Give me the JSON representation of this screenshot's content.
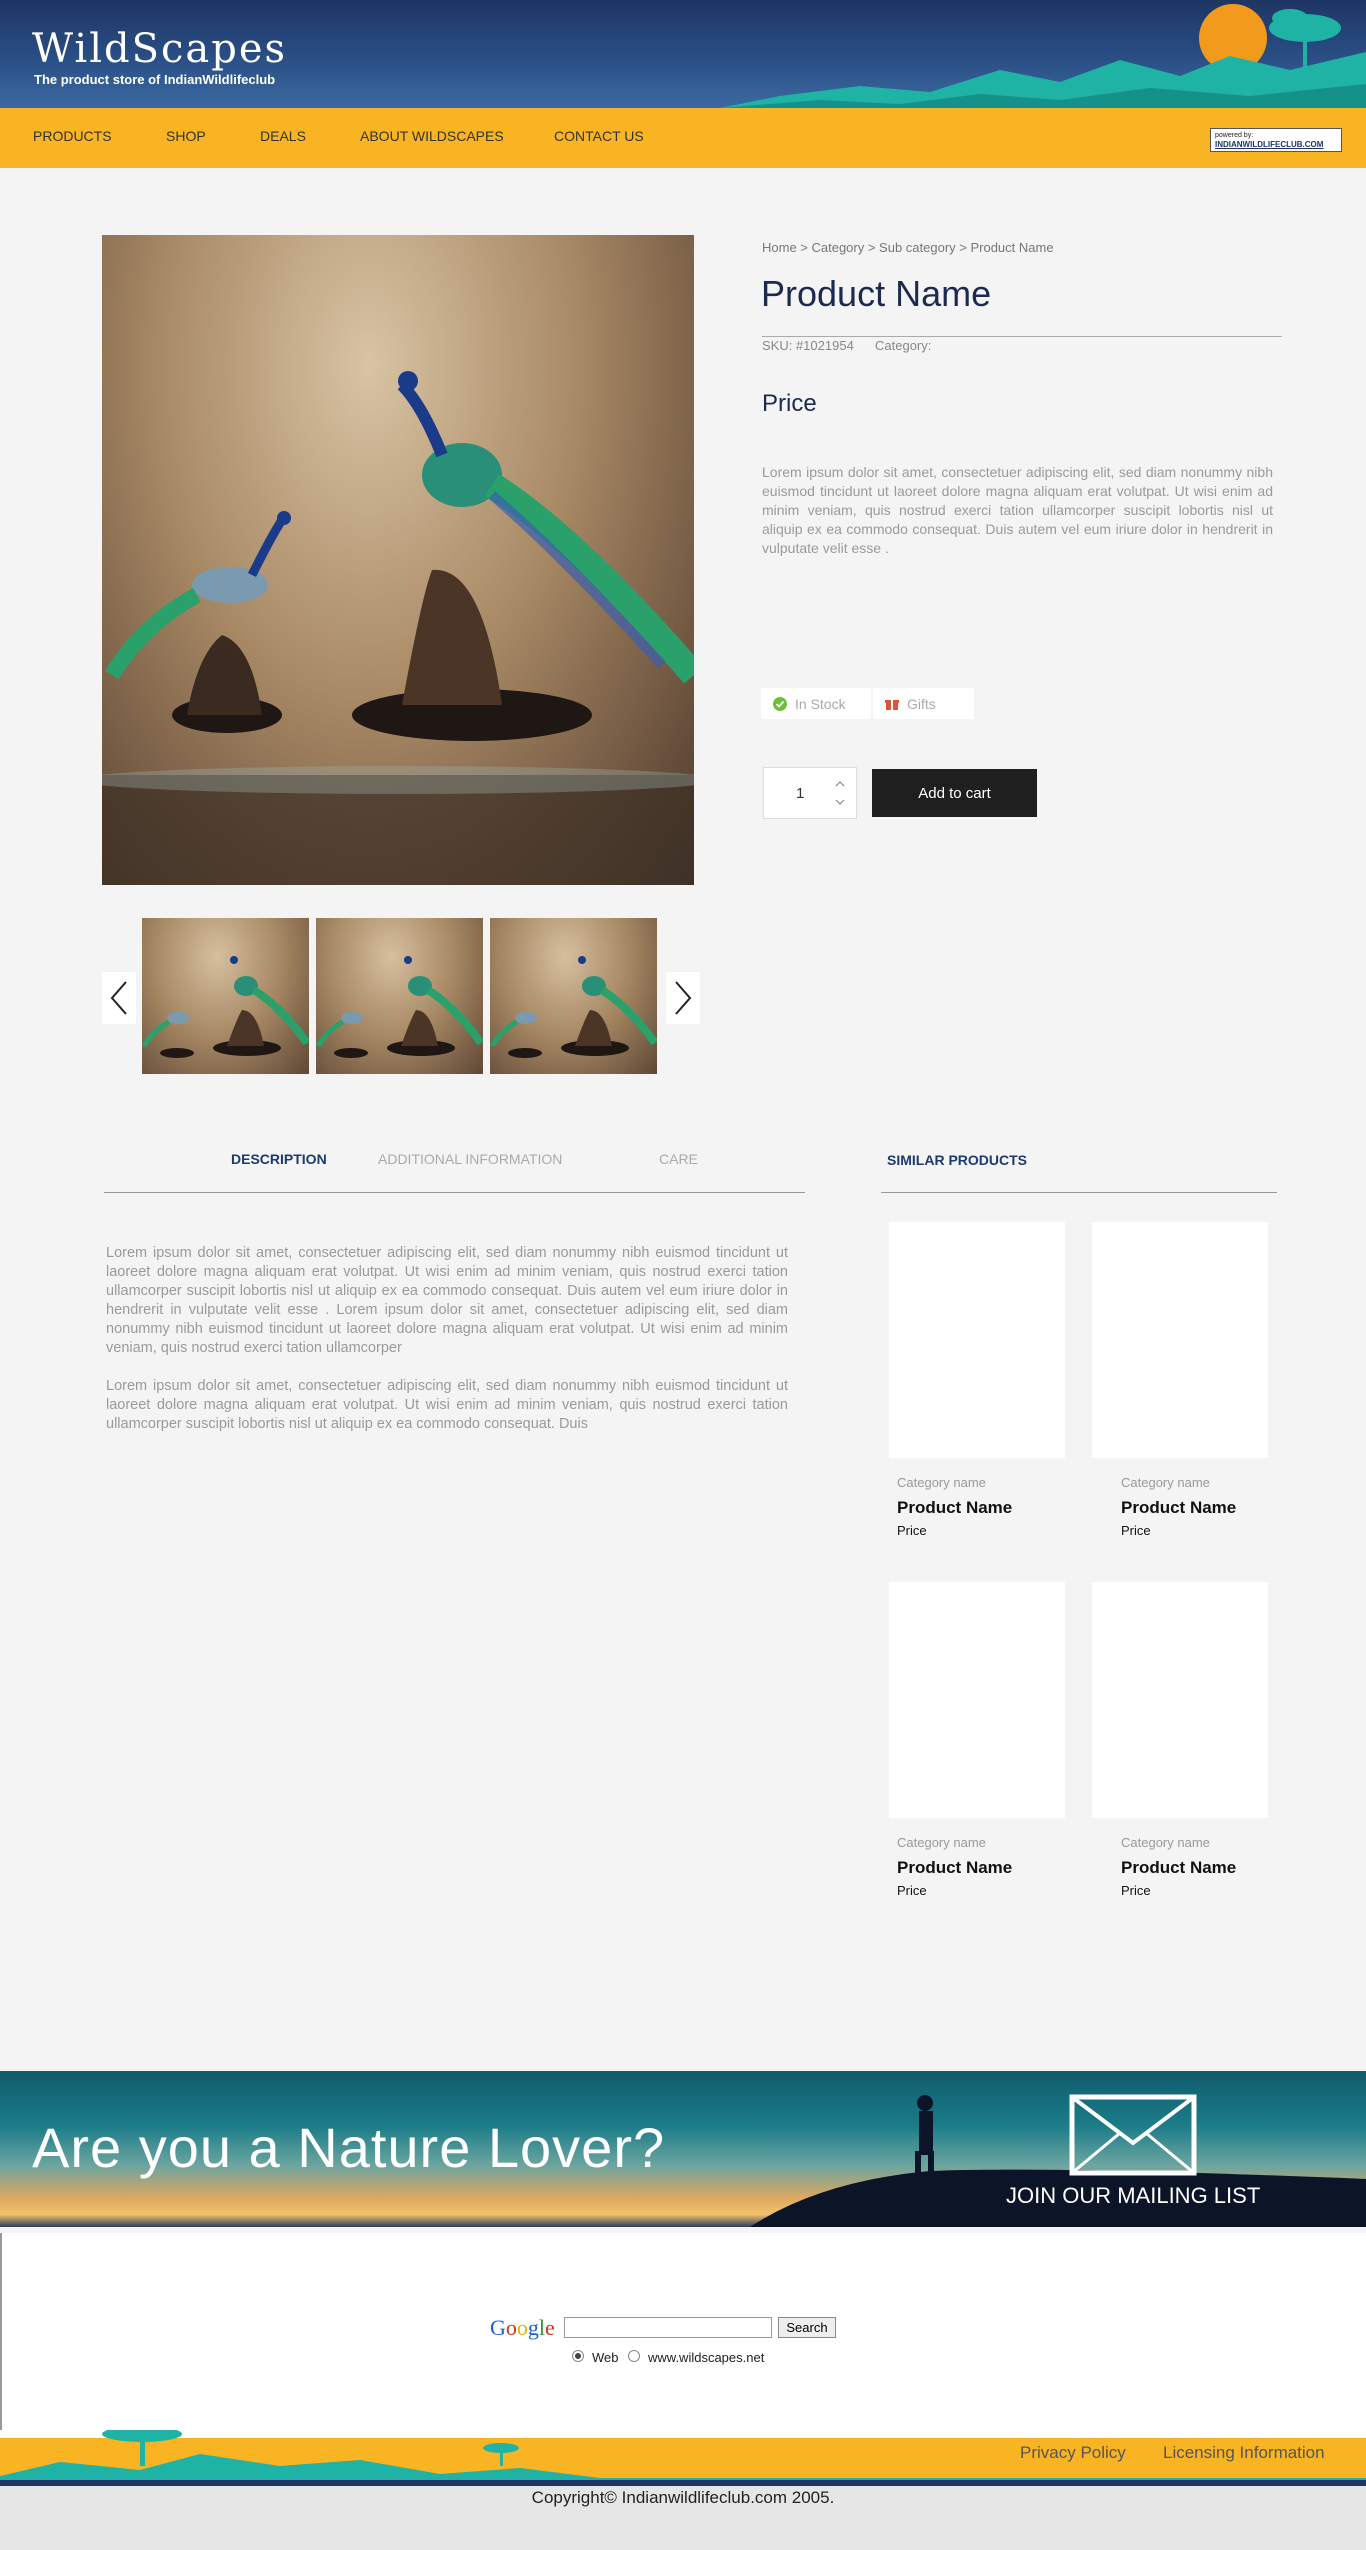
{
  "header": {
    "logo_title": "WildScapes",
    "logo_subtitle": "The product store of IndianWildlifeclub"
  },
  "nav": {
    "items": [
      "PRODUCTS",
      "SHOP",
      "DEALS",
      "ABOUT WILDSCAPES",
      "CONTACT US"
    ],
    "powered_by": "powered by:",
    "powered_site": "INDIANWILDLIFECLUB.COM"
  },
  "product": {
    "breadcrumb": "Home > Category > Sub category > Product Name",
    "name": "Product Name",
    "sku": "SKU: #1021954",
    "category_label": "Category:",
    "price": "Price",
    "description": "Lorem ipsum dolor sit amet, consectetuer adipiscing elit, sed diam nonummy nibh euismod tincidunt ut laoreet dolore magna aliquam erat volutpat. Ut wisi enim ad minim veniam, quis nostrud exerci tation ullamcorper suscipit lobortis nisl ut aliquip ex ea commodo consequat. Duis autem vel eum iriure dolor in hendrerit in vulputate velit esse .",
    "in_stock": "In Stock",
    "gifts": "Gifts",
    "quantity": "1",
    "add_to_cart": "Add to cart"
  },
  "tabs": {
    "description": "DESCRIPTION",
    "additional": "ADDITIONAL INFORMATION",
    "care": "CARE",
    "para1": "Lorem ipsum dolor sit amet, consectetuer adipiscing elit, sed diam nonummy nibh euismod tincidunt ut laoreet dolore magna aliquam erat volutpat. Ut wisi enim ad minim veniam, quis nostrud exerci tation ullamcorper suscipit lobortis nisl ut aliquip ex ea commodo consequat. Duis autem vel eum iriure dolor in hendrerit in vulputate velit esse . Lorem ipsum dolor sit amet, consectetuer adipiscing elit, sed diam nonummy nibh euismod tincidunt ut laoreet dolore magna aliquam erat volutpat. Ut wisi enim ad minim veniam, quis nostrud exerci tation ullamcorper",
    "para2": "Lorem ipsum dolor sit amet, consectetuer adipiscing elit, sed diam nonummy nibh euismod tincidunt ut laoreet dolore magna aliquam erat volutpat. Ut wisi enim ad minim veniam, quis nostrud exerci tation ullamcorper suscipit lobortis nisl ut aliquip ex ea commodo consequat. Duis"
  },
  "similar": {
    "title": "SIMILAR PRODUCTS",
    "items": [
      {
        "category": "Category name",
        "name": "Product Name",
        "price": "Price"
      },
      {
        "category": "Category name",
        "name": "Product Name",
        "price": "Price"
      },
      {
        "category": "Category name",
        "name": "Product Name",
        "price": "Price"
      },
      {
        "category": "Category name",
        "name": "Product Name",
        "price": "Price"
      }
    ]
  },
  "banner": {
    "headline": "Are you a Nature Lover?",
    "mailing": "JOIN OUR MAILING LIST"
  },
  "footer": {
    "google_search_button": "Search",
    "radio_web": "Web",
    "radio_site": "www.wildscapes.net",
    "privacy": "Privacy Policy",
    "licensing": "Licensing Information",
    "copyright": "Copyright© Indianwildlifeclub.com 2005."
  },
  "colors": {
    "header_blue": "#1e3564",
    "nav_yellow": "#f8b422",
    "accent_navy": "#1c2a4f",
    "button_dark": "#1f1f1f"
  }
}
